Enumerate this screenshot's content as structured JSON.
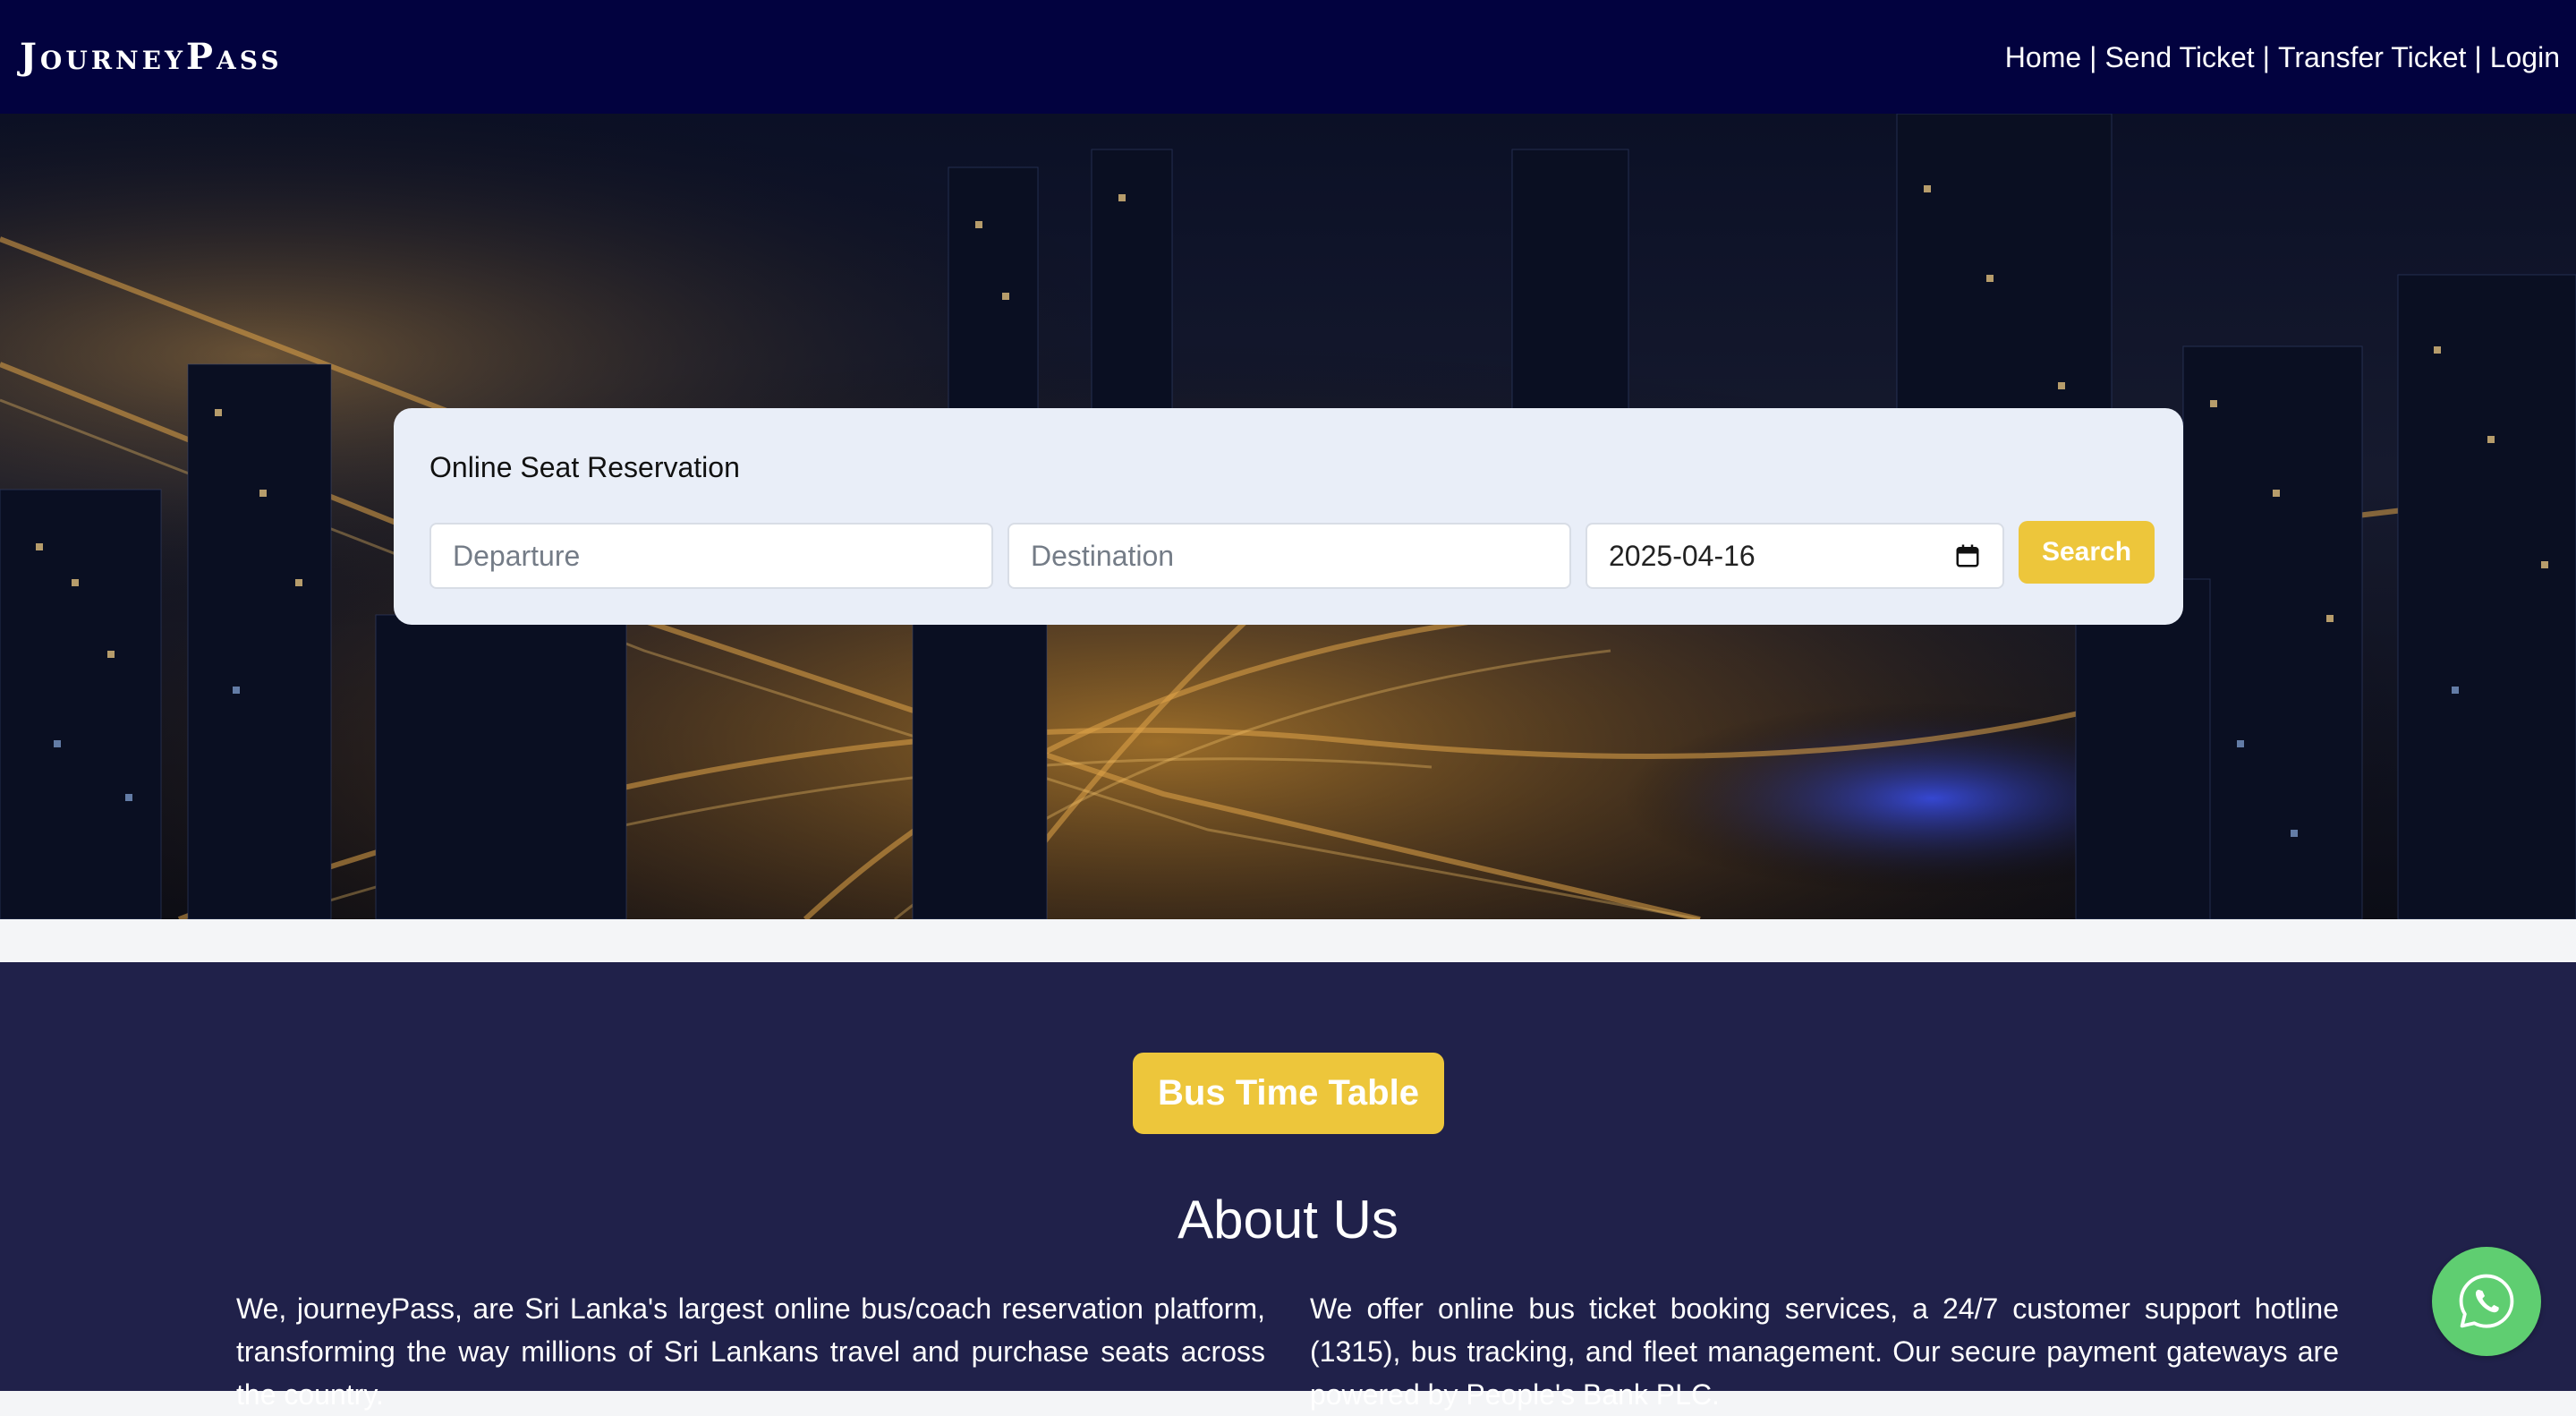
{
  "brand": {
    "name": "JourneyPass"
  },
  "nav": {
    "items": [
      "Home",
      "Send Ticket",
      "Transfer Ticket",
      "Login"
    ],
    "separator": "|"
  },
  "search": {
    "title": "Online Seat Reservation",
    "departure_placeholder": "Departure",
    "destination_placeholder": "Destination",
    "date_value": "2025-04-16",
    "button_label": "Search"
  },
  "timetable": {
    "button_label": "Bus Time Table"
  },
  "about": {
    "title": "About Us",
    "left_text": "We, journeyPass, are Sri Lanka's largest online bus/coach reservation platform, transforming the way millions of Sri Lankans travel and purchase seats across the country.",
    "right_text": "We offer online bus ticket booking services, a 24/7 customer support hotline (1315), bus tracking, and fleet management. Our secure payment gateways are powered by People's Bank PLC."
  },
  "icons": {
    "calendar": "calendar-icon",
    "whatsapp": "whatsapp-icon"
  },
  "colors": {
    "topbar": "#02023f",
    "accent": "#edc63b",
    "about_background": "#20214a",
    "whatsapp": "#5fce71",
    "panel": "#e9eef8"
  }
}
